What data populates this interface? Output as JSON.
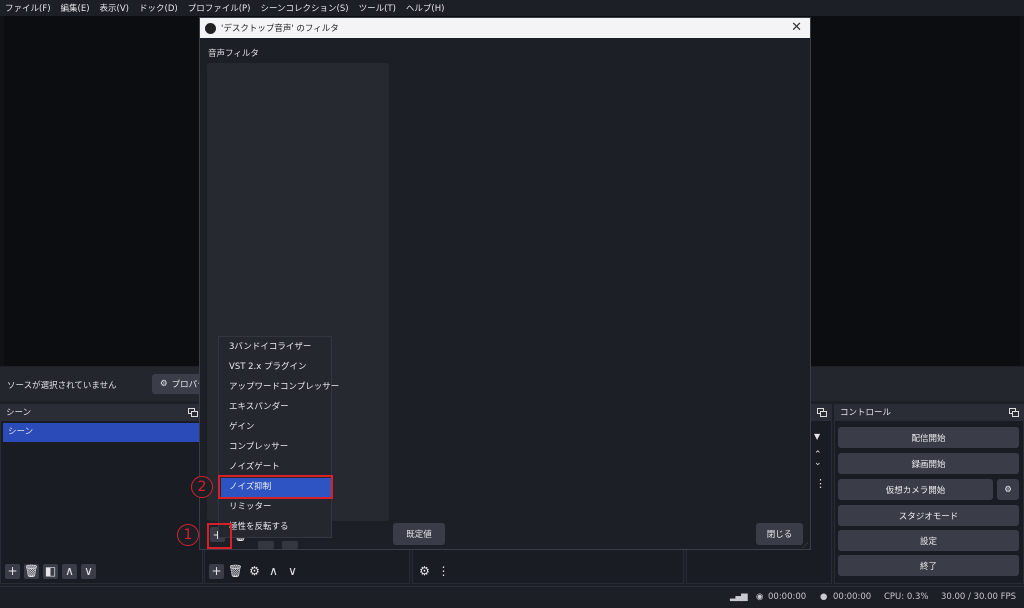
{
  "menubar": [
    "ファイル(F)",
    "編集(E)",
    "表示(V)",
    "ドック(D)",
    "プロファイル(P)",
    "シーンコレクション(S)",
    "ツール(T)",
    "ヘルプ(H)"
  ],
  "source_bar": {
    "no_source_text": "ソースが選択されていません",
    "properties_label": "プロパテ"
  },
  "scenes": {
    "header": "シーン",
    "items": [
      "シーン"
    ]
  },
  "controls": {
    "header": "コントロール",
    "buttons": [
      "配信開始",
      "録画開始",
      "仮想カメラ開始",
      "スタジオモード",
      "設定",
      "終了"
    ]
  },
  "status": {
    "stream_time": "00:00:00",
    "rec_time": "00:00:00",
    "cpu": "CPU: 0.3%",
    "fps": "30.00 / 30.00 FPS"
  },
  "dialog": {
    "title": "'デスクトップ音声' のフィルタ",
    "audio_filter_label": "音声フィルタ",
    "defaults_button": "既定値",
    "close_button": "閉じる"
  },
  "filter_menu": {
    "items": [
      "3バンドイコライザー",
      "VST 2.x プラグイン",
      "アップワードコンプレッサー",
      "エキスパンダー",
      "ゲイン",
      "コンプレッサー",
      "ノイズゲート",
      "ノイズ抑制",
      "リミッター",
      "極性を反転する"
    ],
    "selected_index": 7
  },
  "annotations": {
    "step1": "1",
    "step2": "2"
  },
  "colors": {
    "accent": "#2e54c4",
    "highlight_red": "#d8202a",
    "background": "#1d1f26"
  }
}
